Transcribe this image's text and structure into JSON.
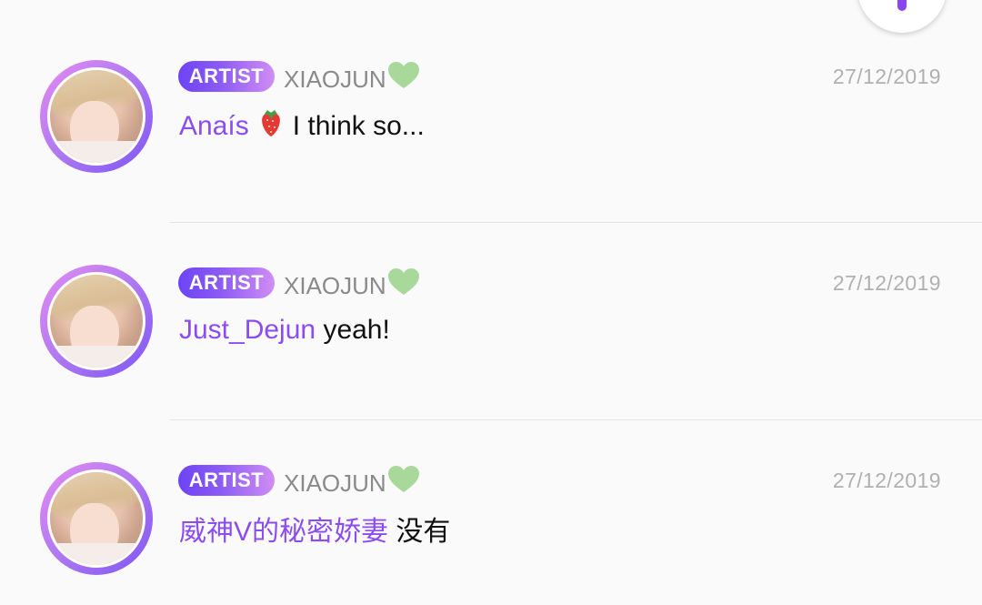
{
  "comments": [
    {
      "badge": "ARTIST",
      "author": "XIAOJUN",
      "author_icon": "green-heart-icon",
      "timestamp": "27/12/2019",
      "mention": "Anaís",
      "mention_icon": "strawberry-icon",
      "text": "I think so..."
    },
    {
      "badge": "ARTIST",
      "author": "XIAOJUN",
      "author_icon": "green-heart-icon",
      "timestamp": "27/12/2019",
      "mention": "Just_Dejun",
      "text": "yeah!"
    },
    {
      "badge": "ARTIST",
      "author": "XIAOJUN",
      "author_icon": "green-heart-icon",
      "timestamp": "27/12/2019",
      "mention": "威神V的秘密娇妻",
      "text": "没有"
    }
  ],
  "colors": {
    "accent": "#8b4df0",
    "badge_start": "#6d43f5",
    "badge_end": "#d08df4",
    "heart": "#a9d99a",
    "divider": "#e4e4e4"
  }
}
